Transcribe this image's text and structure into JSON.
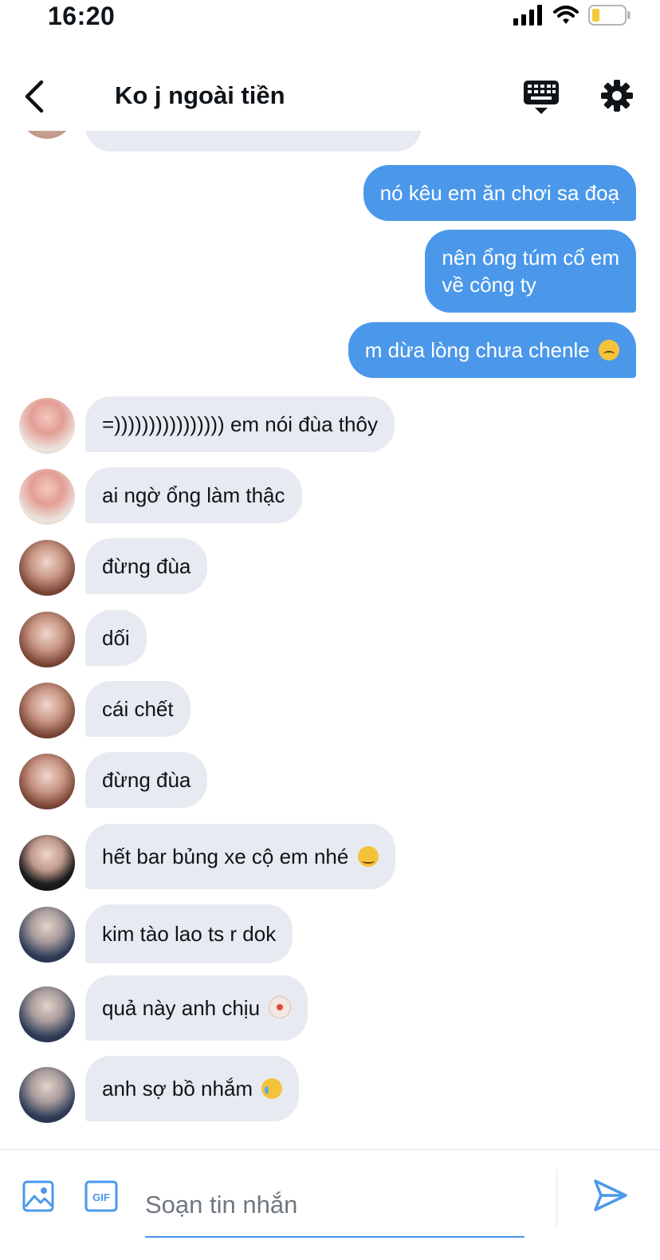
{
  "status_bar": {
    "time": "16:20"
  },
  "header": {
    "title": "Ko j ngoài tiền"
  },
  "messages": [
    {
      "text": "nó kêu em ăn chơi sa đoạ"
    },
    {
      "text": "nên ổng túm cổ em\nvề công ty"
    },
    {
      "text": "m dừa lòng chưa chenle"
    },
    {
      "text": "=)))))))))))))))) em nói đùa thôy"
    },
    {
      "text": "ai ngờ ổng làm thậc"
    },
    {
      "text": "đừng đùa"
    },
    {
      "text": "dối"
    },
    {
      "text": "cái chết"
    },
    {
      "text": "đừng đùa"
    },
    {
      "text": "hết bar bủng xe cộ em nhé"
    },
    {
      "text": "kim tào lao ts r dok"
    },
    {
      "text": "quả này anh chịu"
    },
    {
      "text": "anh sợ bồ nhắm"
    }
  ],
  "composer": {
    "placeholder": "Soạn tin nhắn"
  },
  "colors": {
    "accent": "#4b98ea",
    "incoming_bubble": "#e7eaf0"
  }
}
